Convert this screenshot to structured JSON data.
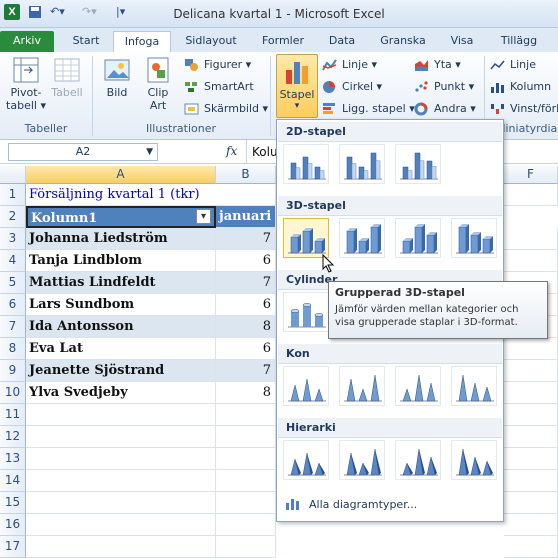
{
  "window": {
    "title": "Delicana kvartal 1  -  Microsoft Excel",
    "app_icon_letter": "X"
  },
  "tabs": [
    "Arkiv",
    "Start",
    "Infoga",
    "Sidlayout",
    "Formler",
    "Data",
    "Granska",
    "Visa",
    "Tillägg"
  ],
  "ribbon": {
    "tables_group": {
      "label": "Tabeller",
      "pivot": "Pivot-",
      "pivot2": "tabell ▾",
      "table": "Tabell"
    },
    "illustrations_group": {
      "label": "Illustrationer",
      "image": "Bild",
      "clip1": "Clip",
      "clip2": "Art",
      "shapes": "Figurer ▾",
      "smartart": "SmartArt",
      "screenshot": "Skärmbild ▾"
    },
    "charts_group": {
      "stapel": "Stapel",
      "stapel_arrow": "▾",
      "line": "Linje ▾",
      "pie": "Cirkel ▾",
      "bar": "Ligg. stapel ▾",
      "area": "Yta ▾",
      "scatter": "Punkt ▾",
      "other": "Andra ▾"
    },
    "sparklines_group": {
      "label": "Miniatyrdiagr",
      "line": "Linje",
      "column": "Kolumn",
      "winloss": "Vinst/förl"
    }
  },
  "formula_bar": {
    "name_box": "A2",
    "fx": "fx",
    "content": "Kolu"
  },
  "columns": [
    "A",
    "B",
    "F"
  ],
  "rows": [
    {
      "num": "1",
      "a": "Försäljning kvartal 1 (tkr)",
      "b": ""
    },
    {
      "num": "2",
      "a": "Kolumn1",
      "b": "januari"
    },
    {
      "num": "3",
      "a": "Johanna Liedström",
      "b": "7"
    },
    {
      "num": "4",
      "a": "Tanja Lindblom",
      "b": "6"
    },
    {
      "num": "5",
      "a": "Mattias Lindfeldt",
      "b": "7"
    },
    {
      "num": "6",
      "a": "Lars Sundbom",
      "b": "6"
    },
    {
      "num": "7",
      "a": "Ida Antonsson",
      "b": "8"
    },
    {
      "num": "8",
      "a": "Eva Lat",
      "b": "6"
    },
    {
      "num": "9",
      "a": "Jeanette Sjöstrand",
      "b": "7"
    },
    {
      "num": "10",
      "a": "Ylva Svedjeby",
      "b": "8"
    },
    {
      "num": "11",
      "a": "",
      "b": ""
    },
    {
      "num": "12",
      "a": "",
      "b": ""
    },
    {
      "num": "13",
      "a": "",
      "b": ""
    },
    {
      "num": "14",
      "a": "",
      "b": ""
    },
    {
      "num": "15",
      "a": "",
      "b": ""
    },
    {
      "num": "16",
      "a": "",
      "b": ""
    },
    {
      "num": "17",
      "a": "",
      "b": ""
    }
  ],
  "gallery": {
    "sections": [
      "2D-stapel",
      "3D-stapel",
      "Cylinder",
      "Kon",
      "Hierarki"
    ],
    "all_types": "Alla diagramtyper..."
  },
  "tooltip": {
    "title": "Grupperad 3D-stapel",
    "body": "Jämför värden mellan kategorier och visa grupperade staplar i 3D-format."
  },
  "colors": {
    "accent_green": "#2a8b3c",
    "header_blue": "#4f81bd",
    "title_blue": "#0000cc",
    "band": "#dce6f1"
  }
}
